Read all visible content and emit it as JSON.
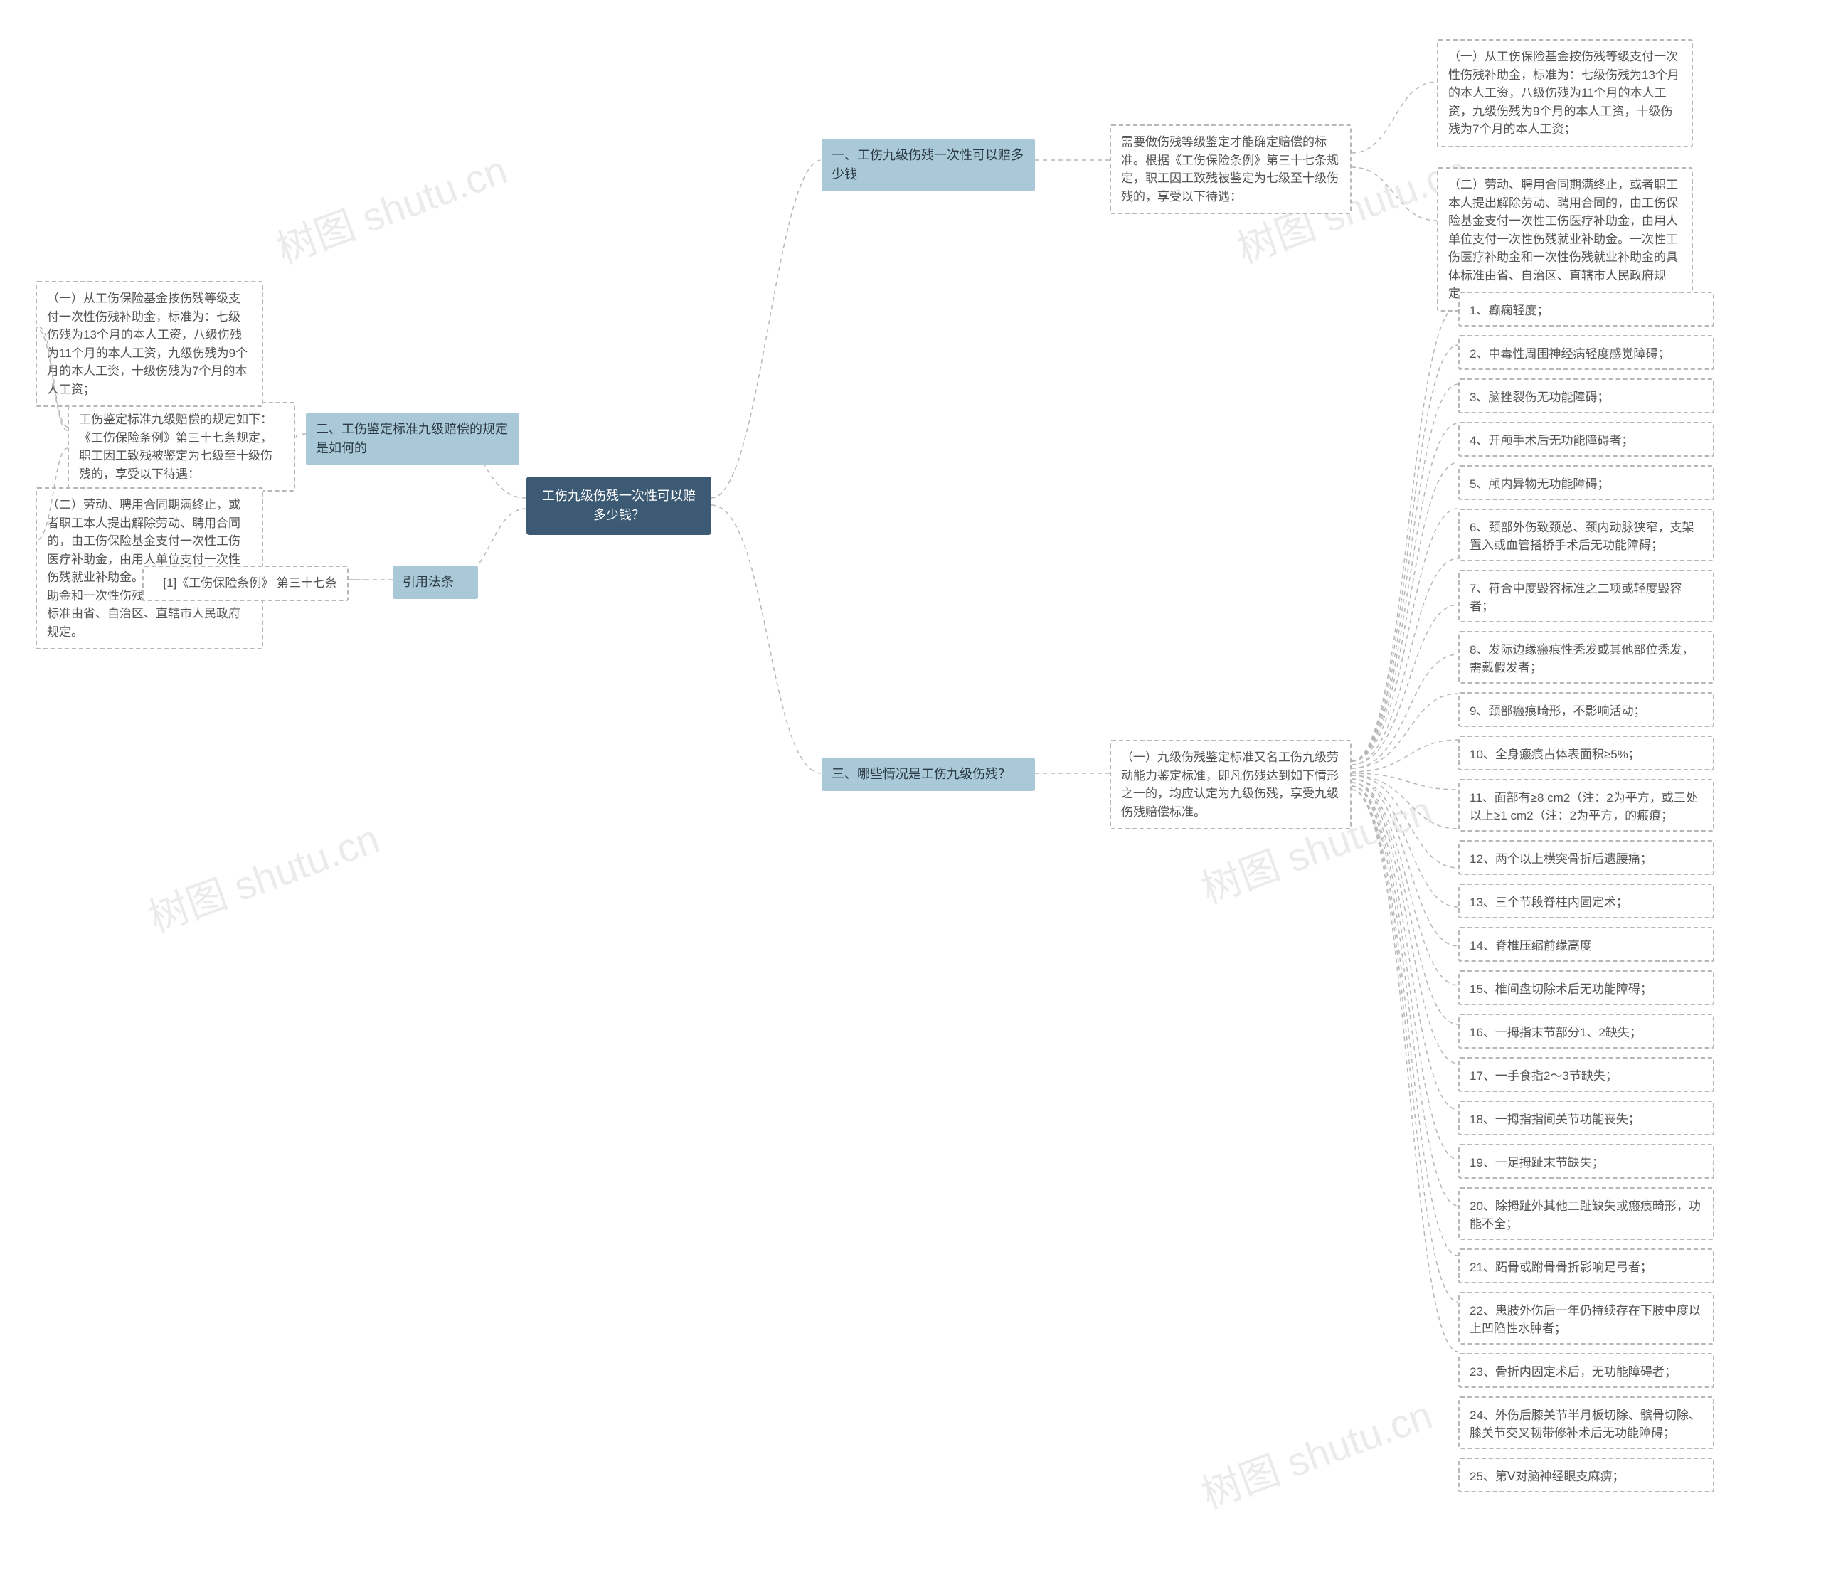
{
  "root": "工伤九级伤残一次性可以赔多少钱？",
  "right": {
    "b1": {
      "title": "一、工伤九级伤残一次性可以赔多少钱",
      "desc": "需要做伤残等级鉴定才能确定赔偿的标准。根据《工伤保险条例》第三十七条规定，职工因工致残被鉴定为七级至十级伤残的，享受以下待遇：",
      "sub1": "（一）从工伤保险基金按伤残等级支付一次性伤残补助金，标准为：七级伤残为13个月的本人工资，八级伤残为11个月的本人工资，九级伤残为9个月的本人工资，十级伤残为7个月的本人工资；",
      "sub2": "（二）劳动、聘用合同期满终止，或者职工本人提出解除劳动、聘用合同的，由工伤保险基金支付一次性工伤医疗补助金，由用人单位支付一次性伤残就业补助金。一次性工伤医疗补助金和一次性伤残就业补助金的具体标准由省、自治区、直辖市人民政府规定。"
    },
    "b3": {
      "title": "三、哪些情况是工伤九级伤残？",
      "desc": "（一）九级伤残鉴定标准又名工伤九级劳动能力鉴定标准，即凡伤残达到如下情形之一的，均应认定为九级伤残，享受九级伤残赔偿标准。",
      "items": [
        "1、癫痫轻度；",
        "2、中毒性周围神经病轻度感觉障碍；",
        "3、脑挫裂伤无功能障碍；",
        "4、开颅手术后无功能障碍者；",
        "5、颅内异物无功能障碍；",
        "6、颈部外伤致颈总、颈内动脉狭窄，支架置入或血管搭桥手术后无功能障碍；",
        "7、符合中度毁容标准之二项或轻度毁容者；",
        "8、发际边缘瘢痕性秃发或其他部位秃发，需戴假发者；",
        "9、颈部瘢痕畸形，不影响活动；",
        "10、全身瘢痕占体表面积≥5%；",
        "11、面部有≥8 cm2（注：2为平方，或三处以上≥1 cm2（注：2为平方，的瘢痕；",
        "12、两个以上横突骨折后遗腰痛；",
        "13、三个节段脊柱内固定术；",
        "14、脊椎压缩前缘高度",
        "15、椎间盘切除术后无功能障碍；",
        "16、一拇指末节部分1、2缺失；",
        "17、一手食指2～3节缺失；",
        "18、一拇指指间关节功能丧失；",
        "19、一足拇趾末节缺失；",
        "20、除拇趾外其他二趾缺失或瘢痕畸形，功能不全；",
        "21、跖骨或跗骨骨折影响足弓者；",
        "22、患肢外伤后一年仍持续存在下肢中度以上凹陷性水肿者；",
        "23、骨折内固定术后，无功能障碍者；",
        "24、外伤后膝关节半月板切除、髌骨切除、膝关节交叉韧带修补术后无功能障碍；",
        "25、第Ⅴ对脑神经眼支麻痹；"
      ]
    }
  },
  "left": {
    "b2": {
      "title": "二、工伤鉴定标准九级赔偿的规定是如何的",
      "desc": "工伤鉴定标准九级赔偿的规定如下：《工伤保险条例》第三十七条规定，职工因工致残被鉴定为七级至十级伤残的，享受以下待遇：",
      "sub1": "（一）从工伤保险基金按伤残等级支付一次性伤残补助金，标准为：七级伤残为13个月的本人工资，八级伤残为11个月的本人工资，九级伤残为9个月的本人工资，十级伤残为7个月的本人工资；",
      "sub2": "（二）劳动、聘用合同期满终止，或者职工本人提出解除劳动、聘用合同的，由工伤保险基金支付一次性工伤医疗补助金，由用人单位支付一次性伤残就业补助金。一次性工伤医疗补助金和一次性伤残就业补助金的具体标准由省、自治区、直辖市人民政府规定。"
    },
    "ref": {
      "title": "引用法条",
      "item": "[1]《工伤保险条例》 第三十七条"
    }
  },
  "watermark": "树图 shutu.cn"
}
